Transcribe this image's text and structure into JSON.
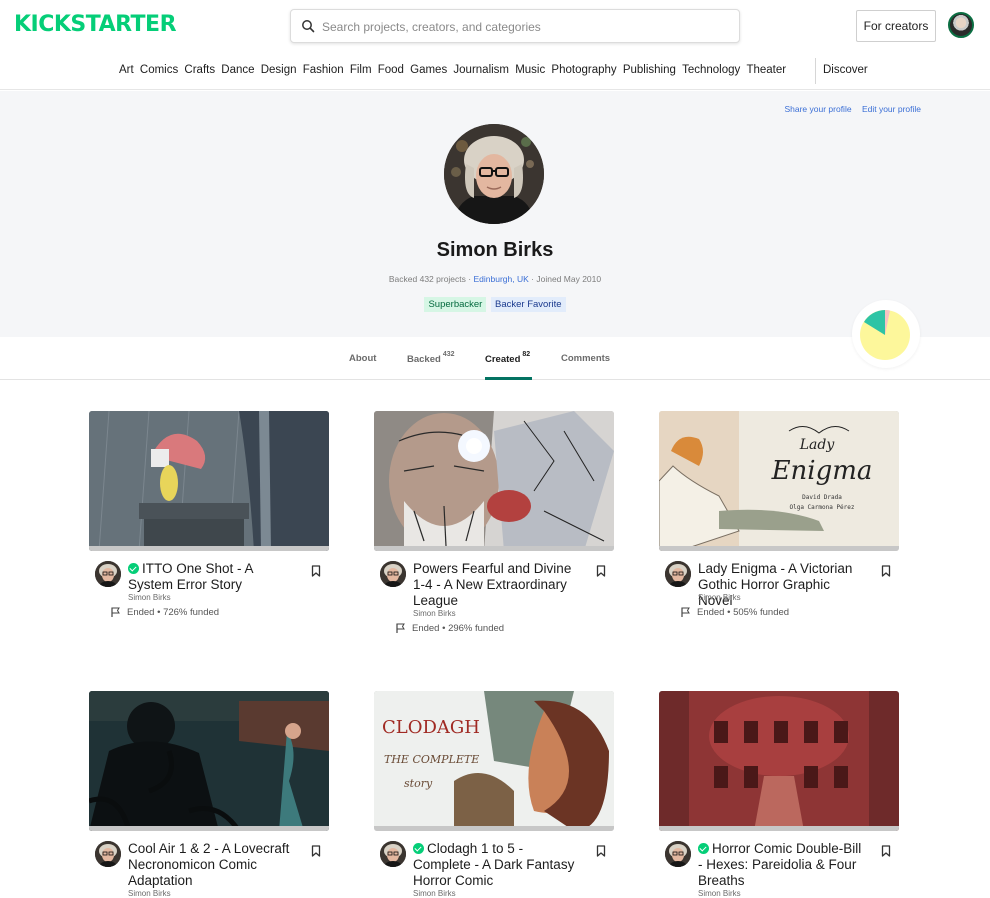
{
  "header": {
    "logo": "KICKSTARTER",
    "search_placeholder": "Search projects, creators, and categories",
    "for_creators_label": "For creators"
  },
  "nav": {
    "categories": [
      "Art",
      "Comics",
      "Crafts",
      "Dance",
      "Design",
      "Fashion",
      "Film",
      "Food",
      "Games",
      "Journalism",
      "Music",
      "Photography",
      "Publishing",
      "Technology",
      "Theater"
    ],
    "discover_label": "Discover"
  },
  "profile": {
    "share_label": "Share your profile",
    "edit_label": "Edit your profile",
    "name": "Simon Birks",
    "backed": "Backed 432 projects",
    "location": "Edinburgh, UK",
    "joined": "Joined May 2010",
    "badges": [
      "Superbacker",
      "Backer Favorite"
    ],
    "pie_colors": [
      "#fdf79b",
      "#2ec4a5",
      "#f6c2c2"
    ]
  },
  "tabs": {
    "about": "About",
    "backed": "Backed",
    "backed_count": "432",
    "created": "Created",
    "created_count": "82",
    "comments": "Comments"
  },
  "projects": [
    {
      "title": "ITTO One Shot - A System Error Story",
      "pwl": true,
      "creator": "Simon Birks",
      "status": "Ended • 726% funded"
    },
    {
      "title": "Powers Fearful and Divine 1-4 - A New Extraordinary League",
      "pwl": false,
      "creator": "Simon Birks",
      "status": "Ended • 296% funded"
    },
    {
      "title": "Lady Enigma - A Victorian Gothic Horror Graphic Novel",
      "pwl": false,
      "creator": "Simon Birks",
      "status": "Ended • 505% funded"
    },
    {
      "title": "Cool Air 1 & 2 - A Lovecraft Necronomicon Comic Adaptation",
      "pwl": false,
      "creator": "Simon Birks",
      "status": ""
    },
    {
      "title": "Clodagh 1 to 5 - Complete - A Dark Fantasy Horror Comic",
      "pwl": true,
      "creator": "Simon Birks",
      "status": ""
    },
    {
      "title": "Horror Comic Double-Bill - Hexes: Pareidolia & Four Breaths",
      "pwl": true,
      "creator": "Simon Birks",
      "status": ""
    }
  ],
  "artwork": {
    "lady_enigma_title_1": "Lady",
    "lady_enigma_title_2": "Enigma",
    "lady_enigma_credits_1": "David Drada",
    "lady_enigma_credits_2": "Olga Carmona Pérez",
    "clodagh_title": "CLODAGH",
    "clodagh_subtitle_1": "THE COMPLETE",
    "clodagh_subtitle_2": "story"
  }
}
